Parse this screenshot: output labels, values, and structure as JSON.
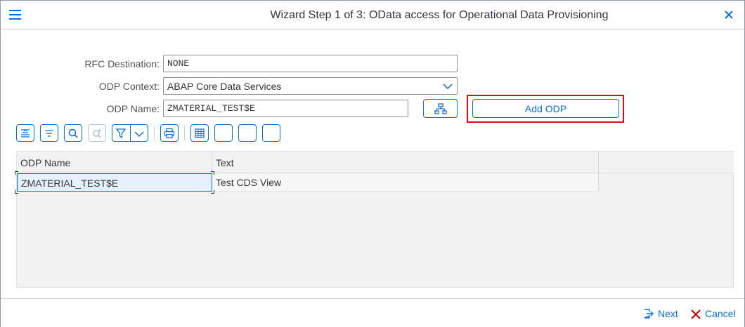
{
  "window": {
    "title": "Wizard Step 1 of 3: OData access for Operational Data Provisioning"
  },
  "form": {
    "rfc_label": "RFC Destination:",
    "rfc_value": "NONE",
    "context_label": "ODP Context:",
    "context_value": "ABAP Core Data Services",
    "name_label": "ODP Name:",
    "name_value": "ZMATERIAL_TEST$E",
    "add_button": "Add ODP"
  },
  "table": {
    "columns": [
      "ODP Name",
      "Text"
    ],
    "rows": [
      {
        "odp_name": "ZMATERIAL_TEST$E",
        "text": "Test CDS View"
      }
    ]
  },
  "footer": {
    "next": "Next",
    "cancel": "Cancel"
  },
  "colors": {
    "accent": "#0a6ed1",
    "highlight": "#d4111a",
    "cancel": "#bb0000"
  }
}
